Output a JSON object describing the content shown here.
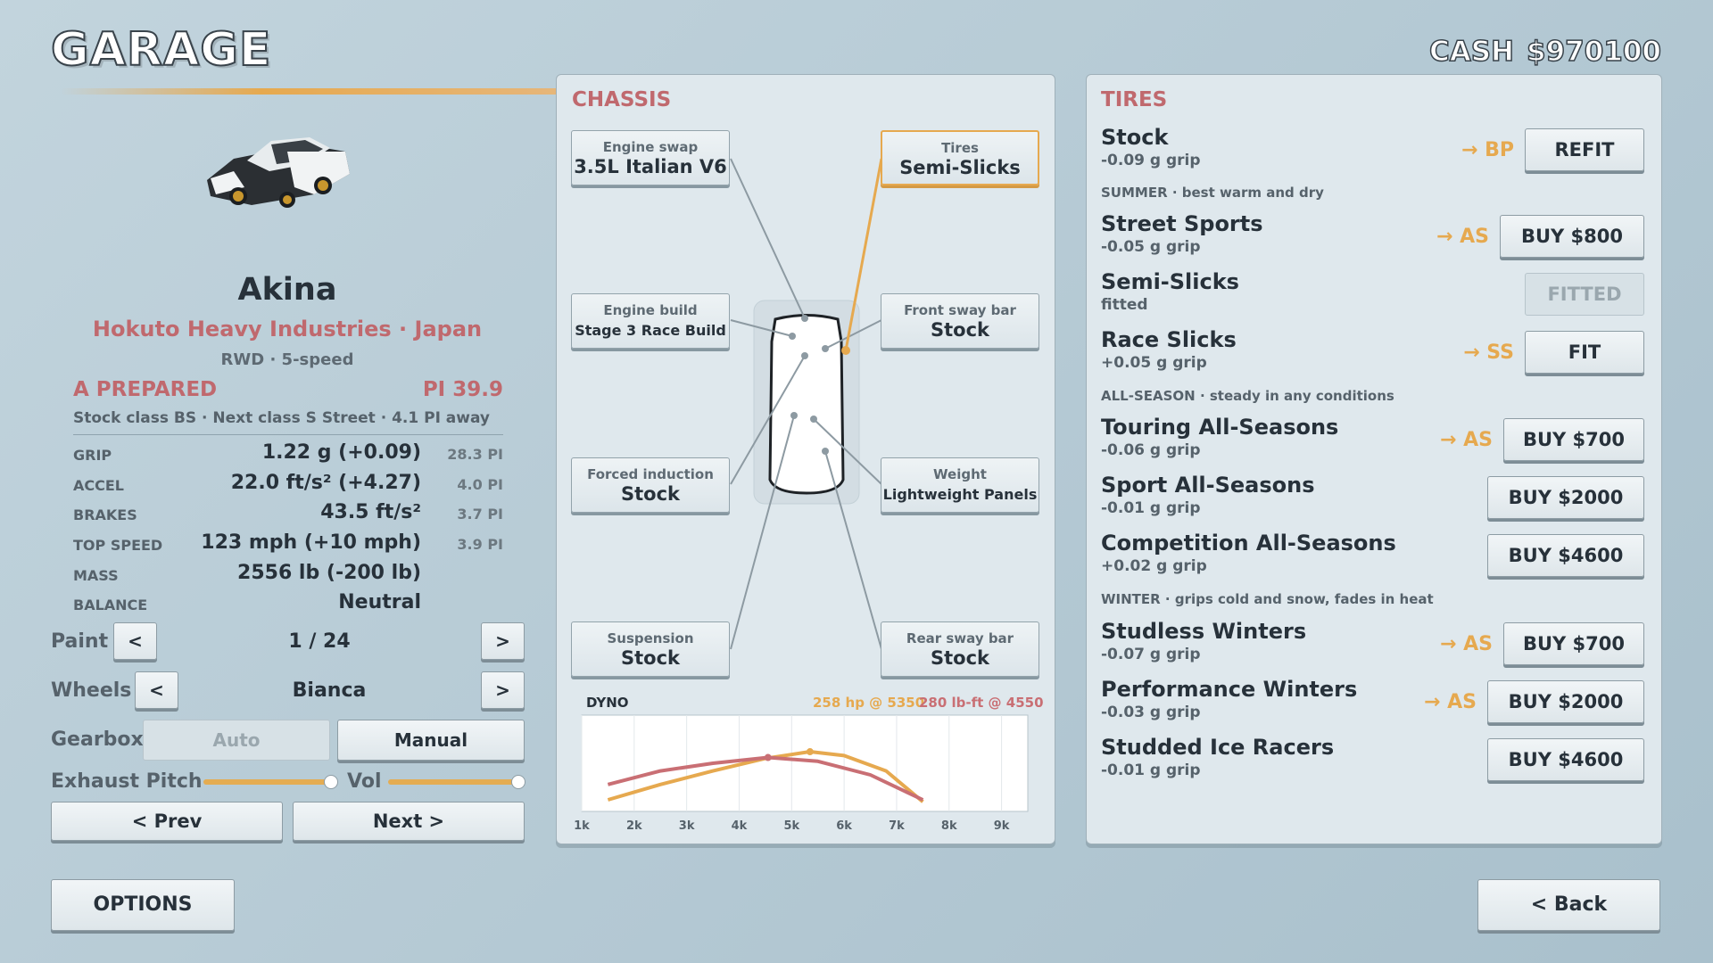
{
  "header": {
    "title": "GARAGE",
    "cash_label": "CASH",
    "cash_value": "$970100"
  },
  "car": {
    "name": "Akina",
    "maker": "Hokuto Heavy Industries · Japan",
    "drivetrain": "RWD · 5-speed",
    "class_label": "A PREPARED",
    "pi": "PI 39.9",
    "class_info": "Stock class BS · Next class S Street · 4.1 PI away",
    "colors": {
      "body": "#2b2f33",
      "roof": "#e8ecee",
      "wheels": "#c8962d"
    }
  },
  "stats": [
    {
      "label": "GRIP",
      "value": "1.22 g  (+0.09)",
      "pi": "28.3 PI"
    },
    {
      "label": "ACCEL",
      "value": "22.0 ft/s²  (+4.27)",
      "pi": "4.0 PI"
    },
    {
      "label": "BRAKES",
      "value": "43.5 ft/s²",
      "pi": "3.7 PI"
    },
    {
      "label": "TOP SPEED",
      "value": "123 mph  (+10 mph)",
      "pi": "3.9 PI"
    },
    {
      "label": "MASS",
      "value": "2556 lb  (-200 lb)",
      "pi": ""
    },
    {
      "label": "BALANCE",
      "value": "Neutral",
      "pi": ""
    }
  ],
  "controls": {
    "paint_label": "Paint",
    "paint_value": "1 / 24",
    "wheels_label": "Wheels",
    "wheels_value": "Bianca",
    "gearbox_label": "Gearbox",
    "gearbox_auto": "Auto",
    "gearbox_manual": "Manual",
    "exhaust_label": "Exhaust Pitch",
    "vol_label": "Vol",
    "exhaust_level": 1.0,
    "vol_level": 1.0,
    "prev_label": "<  Prev",
    "next_label": "Next  >",
    "left_arrow": "<",
    "right_arrow": ">"
  },
  "chassis": {
    "title": "CHASSIS",
    "parts": [
      {
        "label": "Engine swap",
        "value": "3.5L Italian V6"
      },
      {
        "label": "Engine build",
        "value": "Stage 3 Race Build"
      },
      {
        "label": "Forced induction",
        "value": "Stock"
      },
      {
        "label": "Suspension",
        "value": "Stock"
      },
      {
        "label": "Tires",
        "value": "Semi-Slicks"
      },
      {
        "label": "Front sway bar",
        "value": "Stock"
      },
      {
        "label": "Weight",
        "value": "Lightweight Panels"
      },
      {
        "label": "Rear sway bar",
        "value": "Stock"
      }
    ],
    "accent": "#e6a94f"
  },
  "dyno": {
    "title": "DYNO",
    "hp": "258 hp @ 5350",
    "torque": "280 lb-ft @ 4550",
    "hp_color": "#e6a94f",
    "torque_color": "#c96f74"
  },
  "chart_data": {
    "type": "line",
    "x_ticks": [
      "1k",
      "2k",
      "3k",
      "4k",
      "5k",
      "6k",
      "7k",
      "8k",
      "9k"
    ],
    "xlim": [
      1000,
      9500
    ],
    "series": [
      {
        "name": "258 hp @ 5350",
        "color": "#e6a94f",
        "x": [
          1500,
          2500,
          3500,
          4500,
          5350,
          6000,
          6800,
          7500
        ],
        "y": [
          0.12,
          0.28,
          0.42,
          0.55,
          0.62,
          0.58,
          0.42,
          0.1
        ]
      },
      {
        "name": "280 lb-ft @ 4550",
        "color": "#c96f74",
        "x": [
          1500,
          2500,
          3500,
          4550,
          5500,
          6500,
          7500
        ],
        "y": [
          0.28,
          0.42,
          0.5,
          0.56,
          0.52,
          0.38,
          0.12
        ]
      }
    ]
  },
  "tires": {
    "title": "TIRES",
    "rows": [
      {
        "type": "item",
        "name": "Stock",
        "sub": "-0.09 g grip",
        "tag": "→ BP",
        "btn": "REFIT",
        "disabled": false
      },
      {
        "type": "cat",
        "text": "SUMMER · best warm and dry"
      },
      {
        "type": "item",
        "name": "Street Sports",
        "sub": "-0.05 g grip",
        "tag": "→ AS",
        "btn": "BUY  $800",
        "disabled": false
      },
      {
        "type": "item",
        "name": "Semi-Slicks",
        "sub": "fitted",
        "tag": "",
        "btn": "FITTED",
        "disabled": true
      },
      {
        "type": "item",
        "name": "Race Slicks",
        "sub": "+0.05 g grip",
        "tag": "→ SS",
        "btn": "FIT",
        "disabled": false
      },
      {
        "type": "cat",
        "text": "ALL-SEASON · steady in any conditions"
      },
      {
        "type": "item",
        "name": "Touring All-Seasons",
        "sub": "-0.06 g grip",
        "tag": "→ AS",
        "btn": "BUY  $700",
        "disabled": false
      },
      {
        "type": "item",
        "name": "Sport All-Seasons",
        "sub": "-0.01 g grip",
        "tag": "",
        "btn": "BUY  $2000",
        "disabled": false
      },
      {
        "type": "item",
        "name": "Competition All-Seasons",
        "sub": "+0.02 g grip",
        "tag": "",
        "btn": "BUY  $4600",
        "disabled": false
      },
      {
        "type": "cat",
        "text": "WINTER · grips cold and snow, fades in heat"
      },
      {
        "type": "item",
        "name": "Studless Winters",
        "sub": "-0.07 g grip",
        "tag": "→ AS",
        "btn": "BUY  $700",
        "disabled": false
      },
      {
        "type": "item",
        "name": "Performance Winters",
        "sub": "-0.03 g grip",
        "tag": "→ AS",
        "btn": "BUY  $2000",
        "disabled": false
      },
      {
        "type": "item",
        "name": "Studded Ice Racers",
        "sub": "-0.01 g grip",
        "tag": "",
        "btn": "BUY  $4600",
        "disabled": false
      }
    ]
  },
  "footer": {
    "options_label": "OPTIONS",
    "back_label": "< Back"
  }
}
